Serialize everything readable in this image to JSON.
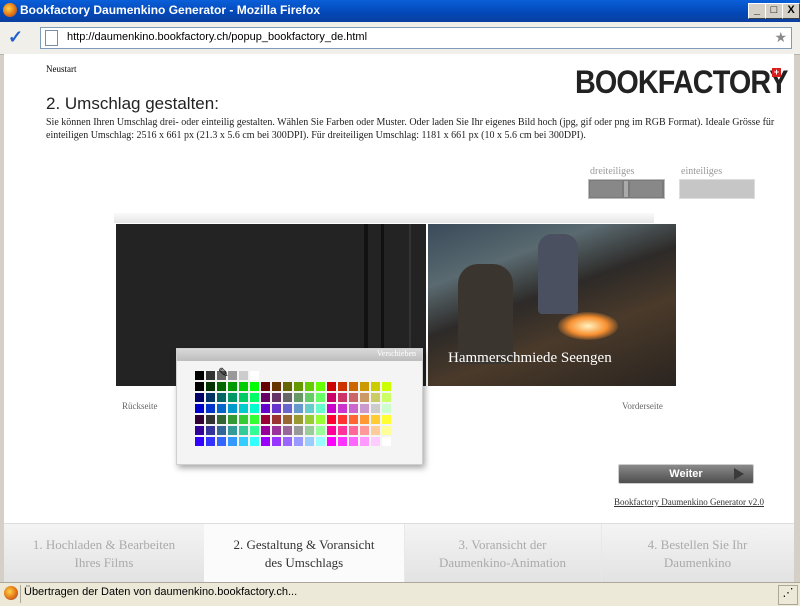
{
  "window": {
    "title": "Bookfactory Daumenkino Generator - Mozilla Firefox",
    "buttons": {
      "minimize": "_",
      "maximize": "□",
      "close": "X"
    }
  },
  "address": {
    "url": "http://daumenkino.bookfactory.ch/popup_bookfactory_de.html"
  },
  "page": {
    "restart_label": "Neustart",
    "logo": "BOOKFACTORY",
    "logo_mark": "+",
    "heading": "2. Umschlag gestalten:",
    "description": "Sie können Ihren Umschlag drei- oder einteilig gestalten. Wählen Sie Farben oder Muster. Oder laden Sie Ihr eigenes Bild hoch (jpg, gif oder png im RGB Format). Ideale Grösse für einteiligen Umschlag: 2516 x 661 px (21.3 x 5.6 cm bei 300DPI). Für dreiteiligen Umschlag: 1181 x 661 px (10 x 5.6 cm bei 300DPI).",
    "options": {
      "three_part_label": "dreiteiliges",
      "one_part_label": "einteiliges"
    },
    "cover_title": "Hammerschmiede Seengen",
    "back_caption": "Rückseite",
    "front_caption": "Vorderseite",
    "picker": {
      "title": "Verschieben",
      "top_row": [
        "#000000",
        "#333333",
        "#666666",
        "#999999",
        "#cccccc",
        "#ffffff"
      ]
    },
    "next_button": "Weiter",
    "version_link": "Bookfactory Daumenkino Generator v2.0"
  },
  "steps": [
    {
      "label_line1": "1. Hochladen & Bearbeiten",
      "label_line2": "Ihres Films",
      "state": "inactive"
    },
    {
      "label_line1": "2. Gestaltung & Voransicht",
      "label_line2": "des Umschlags",
      "state": "active"
    },
    {
      "label_line1": "3. Voransicht der",
      "label_line2": "Daumenkino-Animation",
      "state": "inactive"
    },
    {
      "label_line1": "4. Bestellen Sie Ihr",
      "label_line2": "Daumenkino",
      "state": "inactive"
    }
  ],
  "status": {
    "text": "Übertragen der Daten von daumenkino.bookfactory.ch..."
  },
  "colors": {
    "accent": "#0347b6",
    "active_step_text": "#333333",
    "inactive_step_text": "#aaaaaa"
  }
}
